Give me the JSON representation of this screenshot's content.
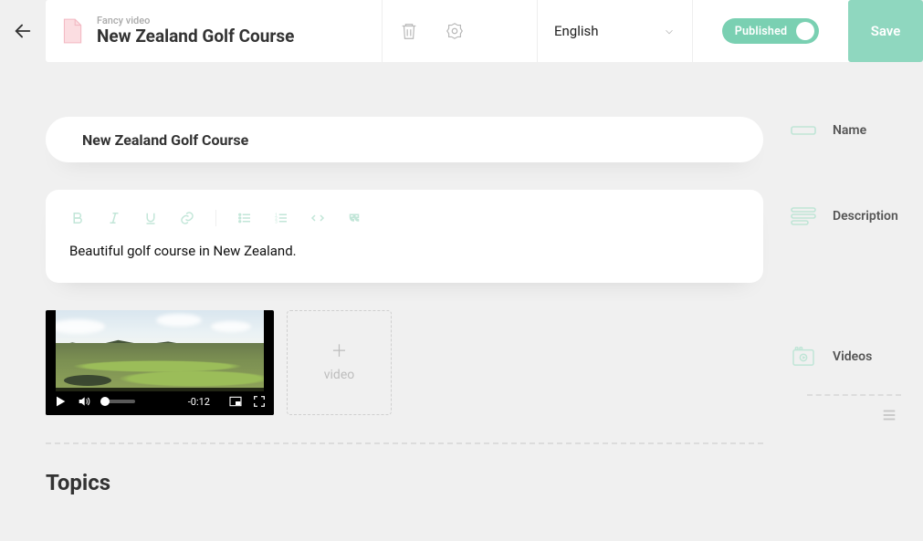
{
  "header": {
    "pretitle": "Fancy video",
    "title": "New Zealand Golf Course",
    "language": "English",
    "publish_label": "Published",
    "save_label": "Save"
  },
  "fields": {
    "name": "New Zealand Golf Course",
    "description": "Beautiful golf course in New Zealand."
  },
  "video": {
    "time_remaining": "-0:12",
    "add_label": "video"
  },
  "labels": {
    "name": "Name",
    "description": "Description",
    "videos": "Videos"
  },
  "sections": {
    "topics": "Topics"
  }
}
